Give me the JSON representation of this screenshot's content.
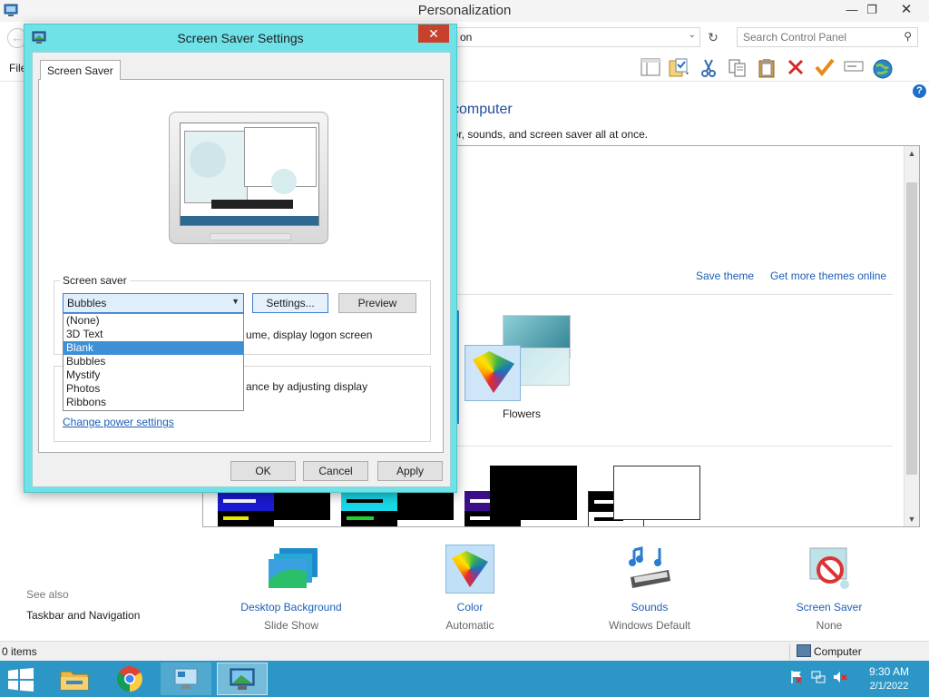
{
  "window": {
    "title": "Personalization",
    "minimize_icon": "minimize-icon",
    "restore_icon": "restore-icon",
    "close_icon": "close-icon"
  },
  "address": {
    "value_fragment": "on",
    "search_placeholder": "Search Control Panel"
  },
  "menu": {
    "file_fragment": "File"
  },
  "toolbar_icons": [
    "layout-icon",
    "properties-icon",
    "cut-icon",
    "copy-icon",
    "paste-icon",
    "delete-icon",
    "check-icon",
    "rename-icon",
    "globe-icon"
  ],
  "main": {
    "heading_fragment": "computer",
    "description_fragment": "lor, sounds, and screen saver all at once.",
    "save_theme": "Save theme",
    "get_more_themes": "Get more themes online",
    "flowers_label": "Flowers"
  },
  "bottom": {
    "see_also": "See also",
    "taskbar_navigation": "Taskbar and Navigation",
    "items": [
      {
        "label": "Desktop Background",
        "sub": "Slide Show"
      },
      {
        "label": "Color",
        "sub": "Automatic"
      },
      {
        "label": "Sounds",
        "sub": "Windows Default"
      },
      {
        "label": "Screen Saver",
        "sub": "None"
      }
    ]
  },
  "status": {
    "items_count": "0 items",
    "computer": "Computer"
  },
  "taskbar": {
    "time": "9:30 AM",
    "date": "2/1/2022"
  },
  "dialog": {
    "title": "Screen Saver Settings",
    "tab_label": "Screen Saver",
    "group_label": "Screen saver",
    "selected_value": "Bubbles",
    "settings_button": "Settings...",
    "preview_button": "Preview",
    "wait_text_fragment": "ume, display logon screen",
    "power_text_fragment": "ance by adjusting display",
    "power_link": "Change power settings",
    "options": [
      "(None)",
      "3D Text",
      "Blank",
      "Bubbles",
      "Mystify",
      "Photos",
      "Ribbons"
    ],
    "highlighted_option": "Blank",
    "ok_button": "OK",
    "cancel_button": "Cancel",
    "apply_button": "Apply"
  },
  "colors": {
    "dialog_frame": "#6fe2e8",
    "close_button": "#c7412c",
    "taskbar": "#2c97c6",
    "link": "#1e5fb4",
    "selection": "#3d8fd6"
  }
}
